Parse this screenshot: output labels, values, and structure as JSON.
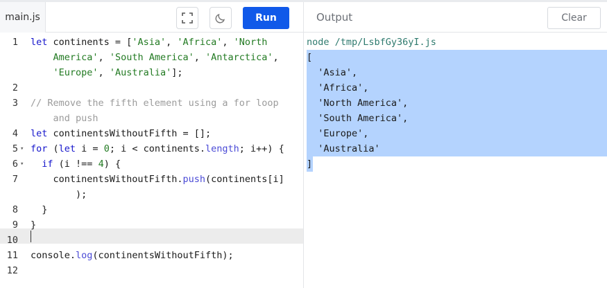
{
  "editor": {
    "file_tab": "main.js",
    "fullscreen_icon": "fullscreen-icon",
    "theme_icon": "moon-icon",
    "run_label": "Run",
    "run_color": "#1059e9",
    "lines": [
      {
        "num": "1",
        "tokens": [
          [
            "kw",
            "let"
          ],
          [
            "",
            "continents = ["
          ],
          [
            "st",
            "'Asia'"
          ],
          [
            "",
            ", "
          ],
          [
            "st",
            "'Africa'"
          ],
          [
            "",
            ", "
          ],
          [
            "st",
            "'North"
          ]
        ]
      },
      {
        "num": "",
        "tokens": [
          [
            "st",
            "    America'"
          ],
          [
            "",
            ", "
          ],
          [
            "st",
            "'South America'"
          ],
          [
            "",
            ", "
          ],
          [
            "st",
            "'Antarctica'"
          ],
          [
            "",
            ","
          ]
        ]
      },
      {
        "num": "",
        "tokens": [
          [
            "",
            "    "
          ],
          [
            "st",
            "'Europe'"
          ],
          [
            "",
            ", "
          ],
          [
            "st",
            "'Australia'"
          ],
          [
            "",
            "];"
          ]
        ]
      },
      {
        "num": "2",
        "tokens": []
      },
      {
        "num": "3",
        "tokens": [
          [
            "cm",
            "// Remove the fifth element using a for loop"
          ]
        ]
      },
      {
        "num": "",
        "tokens": [
          [
            "cm",
            "    and push"
          ]
        ]
      },
      {
        "num": "4",
        "tokens": [
          [
            "kw",
            "let"
          ],
          [
            "",
            "continentsWithoutFifth = [];"
          ]
        ]
      },
      {
        "num": "5",
        "fold": true,
        "tokens": [
          [
            "kw",
            "for"
          ],
          [
            "",
            " ("
          ],
          [
            "kw",
            "let"
          ],
          [
            "",
            " i = "
          ],
          [
            "nu",
            "0"
          ],
          [
            "",
            "; i < continents."
          ],
          [
            "pr",
            "length"
          ],
          [
            "",
            "; i++) {"
          ]
        ]
      },
      {
        "num": "6",
        "fold": true,
        "tokens": [
          [
            "",
            "  "
          ],
          [
            "kw",
            "if"
          ],
          [
            "",
            " (i !== "
          ],
          [
            "nu",
            "4"
          ],
          [
            "",
            ") {"
          ]
        ]
      },
      {
        "num": "7",
        "tokens": [
          [
            "",
            "    continentsWithoutFifth."
          ],
          [
            "pr",
            "push"
          ],
          [
            "",
            "(continents[i]"
          ]
        ]
      },
      {
        "num": "",
        "tokens": [
          [
            "",
            "        );"
          ]
        ]
      },
      {
        "num": "8",
        "tokens": [
          [
            "",
            "  }"
          ]
        ]
      },
      {
        "num": "9",
        "tokens": [
          [
            "",
            "}"
          ]
        ]
      },
      {
        "num": "10",
        "tokens": []
      },
      {
        "num": "11",
        "tokens": [
          [
            "",
            "console."
          ],
          [
            "pr",
            "log"
          ],
          [
            "",
            "(continentsWithoutFifth);"
          ]
        ]
      },
      {
        "num": "12",
        "tokens": []
      }
    ]
  },
  "output": {
    "title": "Output",
    "clear_label": "Clear",
    "command": "node /tmp/LsbfGy36yI.js",
    "lines": [
      "[",
      "  'Asia',",
      "  'Africa',",
      "  'North America',",
      "  'South America',",
      "  'Europe',",
      "  'Australia'",
      "]"
    ]
  }
}
